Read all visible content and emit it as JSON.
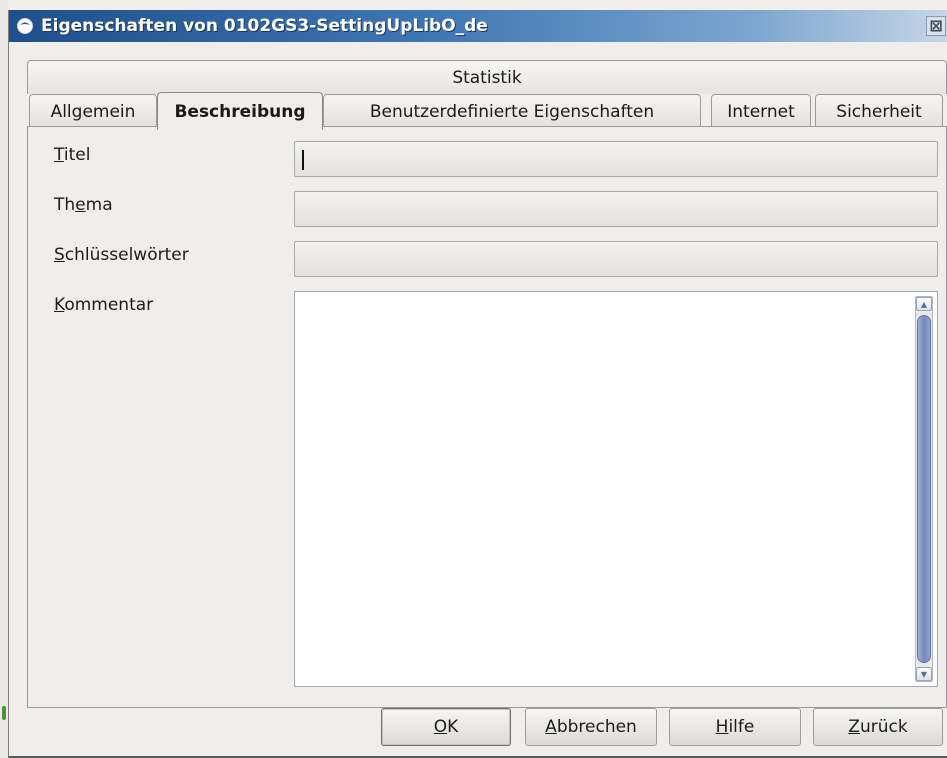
{
  "window": {
    "title": "Eigenschaften von 0102GS3-SettingUpLibO_de",
    "close_glyph": "⊠"
  },
  "tabs": {
    "row2": [
      "Statistik"
    ],
    "row1": [
      "Allgemein",
      "Beschreibung",
      "Benutzerdefinierte Eigenschaften",
      "Internet",
      "Sicherheit"
    ],
    "active": "Beschreibung"
  },
  "form": {
    "titel": {
      "label_mn": "T",
      "label_rest": "itel",
      "value": ""
    },
    "thema": {
      "label_a": "Th",
      "label_mn": "e",
      "label_b": "ma",
      "value": ""
    },
    "schluesselwoerter": {
      "label_mn": "S",
      "label_rest": "chlüsselwörter",
      "value": ""
    },
    "kommentar": {
      "label_mn": "K",
      "label_rest": "ommentar",
      "value": ""
    }
  },
  "buttons": {
    "ok": {
      "mn": "O",
      "rest": "K"
    },
    "abbrechen": {
      "mn": "A",
      "rest": "bbrechen"
    },
    "hilfe": {
      "mn": "H",
      "rest": "ilfe"
    },
    "zurueck": {
      "mn": "Z",
      "rest": "urück"
    }
  },
  "icons": {
    "window": "app-window-icon",
    "close": "close-icon",
    "scroll_up": "scroll-up-arrow-icon",
    "scroll_down": "scroll-down-arrow-icon"
  },
  "colors": {
    "titlebar_start": "#1f4f8a",
    "titlebar_end": "#c7d6e6",
    "scroll_thumb": "#7388bb"
  }
}
